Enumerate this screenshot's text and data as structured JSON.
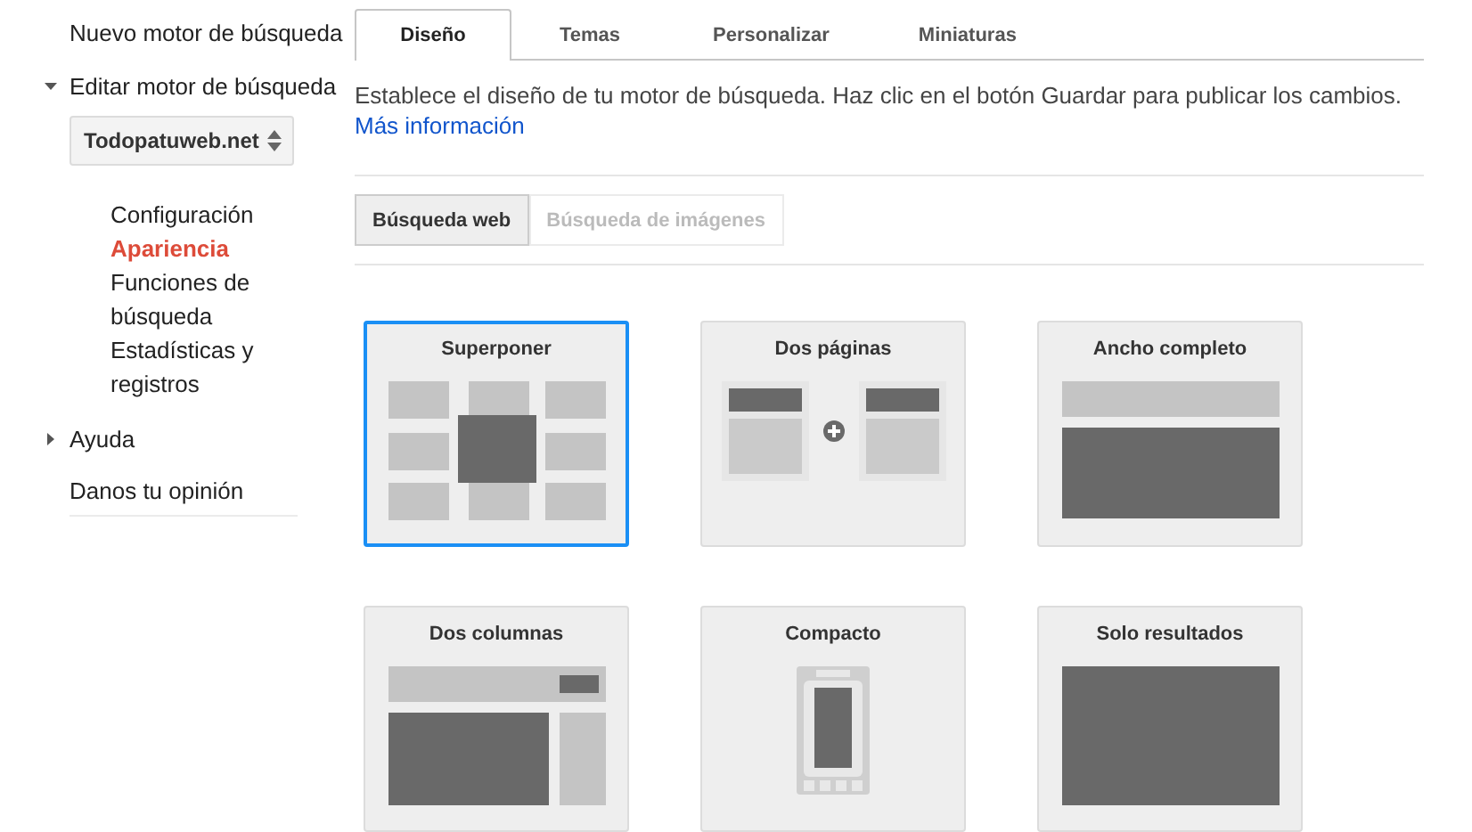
{
  "sidebar": {
    "items": [
      {
        "label": "Nuevo motor de búsqueda",
        "kind": "link"
      },
      {
        "label": "Editar motor de búsqueda",
        "kind": "section",
        "expanded": true,
        "select": {
          "value": "Todopatuweb.net"
        },
        "children": [
          {
            "label": "Configuración",
            "selected": false
          },
          {
            "label": "Apariencia",
            "selected": true
          },
          {
            "label": "Funciones de búsqueda",
            "selected": false
          },
          {
            "label": "Estadísticas y registros",
            "selected": false
          }
        ]
      },
      {
        "label": "Ayuda",
        "kind": "section",
        "expanded": false
      },
      {
        "label": "Danos tu opinión",
        "kind": "link"
      }
    ]
  },
  "tabs": [
    {
      "label": "Diseño",
      "selected": true
    },
    {
      "label": "Temas",
      "selected": false
    },
    {
      "label": "Personalizar",
      "selected": false
    },
    {
      "label": "Miniaturas",
      "selected": false
    }
  ],
  "description": {
    "text": "Establece el diseño de tu motor de búsqueda. Haz clic en el botón Guardar para publicar los cambios.",
    "link": "Más información"
  },
  "search_types": [
    {
      "label": "Búsqueda web",
      "selected": true
    },
    {
      "label": "Búsqueda de imágenes",
      "selected": false
    }
  ],
  "layouts": [
    {
      "title": "Superponer",
      "kind": "overlay",
      "selected": true
    },
    {
      "title": "Dos páginas",
      "kind": "two-page",
      "selected": false
    },
    {
      "title": "Ancho completo",
      "kind": "full-width",
      "selected": false
    },
    {
      "title": "Dos columnas",
      "kind": "two-column",
      "selected": false
    },
    {
      "title": "Compacto",
      "kind": "compact",
      "selected": false
    },
    {
      "title": "Solo resultados",
      "kind": "results-only",
      "selected": false
    }
  ]
}
